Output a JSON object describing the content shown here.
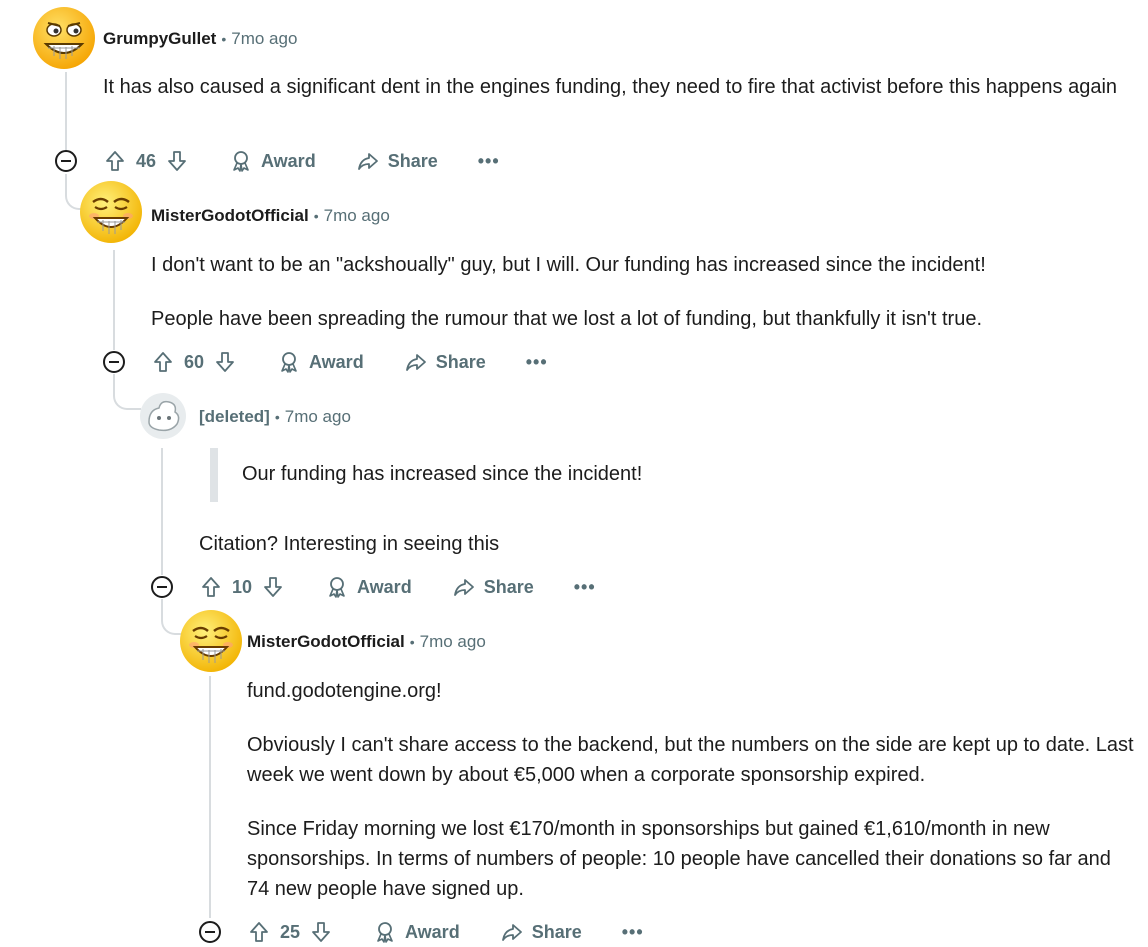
{
  "comments": [
    {
      "author": "GrumpyGullet",
      "sep": "•",
      "time": "7mo ago",
      "paragraphs": [
        "It has also caused a significant dent in the engines funding, they need to fire that activist before this happens again"
      ],
      "votes": "46",
      "award": "Award",
      "share": "Share",
      "more": "•••"
    },
    {
      "author": "MisterGodotOfficial",
      "sep": "•",
      "time": "7mo ago",
      "paragraphs": [
        "I don't want to be an \"ackshoually\" guy, but I will. Our funding has increased since the incident!",
        "People have been spreading the rumour that we lost a lot of funding, but thankfully it isn't true."
      ],
      "votes": "60",
      "award": "Award",
      "share": "Share",
      "more": "•••"
    },
    {
      "author": "[deleted]",
      "sep": "•",
      "time": "7mo ago",
      "quote": "Our funding has increased since the incident!",
      "paragraphs": [
        "Citation? Interesting in seeing this"
      ],
      "votes": "10",
      "award": "Award",
      "share": "Share",
      "more": "•••"
    },
    {
      "author": "MisterGodotOfficial",
      "sep": "•",
      "time": "7mo ago",
      "paragraphs": [
        "fund.godotengine.org!",
        "Obviously I can't share access to the backend, but the numbers on the side are kept up to date. Last week we went down by about €5,000 when a corporate sponsorship expired.",
        "Since Friday morning we lost €170/month in sponsorships but gained €1,610/month in new sponsorships. In terms of numbers of people: 10 people have cancelled their donations so far and 74 new people have signed up."
      ],
      "votes": "25",
      "award": "Award",
      "share": "Share",
      "more": "•••"
    }
  ],
  "icons": {
    "upvote": "upvote-icon",
    "downvote": "downvote-icon",
    "award": "award-icon",
    "share": "share-icon",
    "more": "more-options-icon",
    "collapse": "collapse-icon"
  },
  "colors": {
    "text": "#1c1c1c",
    "meta": "#576f76",
    "thread": "#d8dcdf",
    "quote_bar": "#dfe3e6",
    "emoji_yellow": "#ffcc33"
  }
}
